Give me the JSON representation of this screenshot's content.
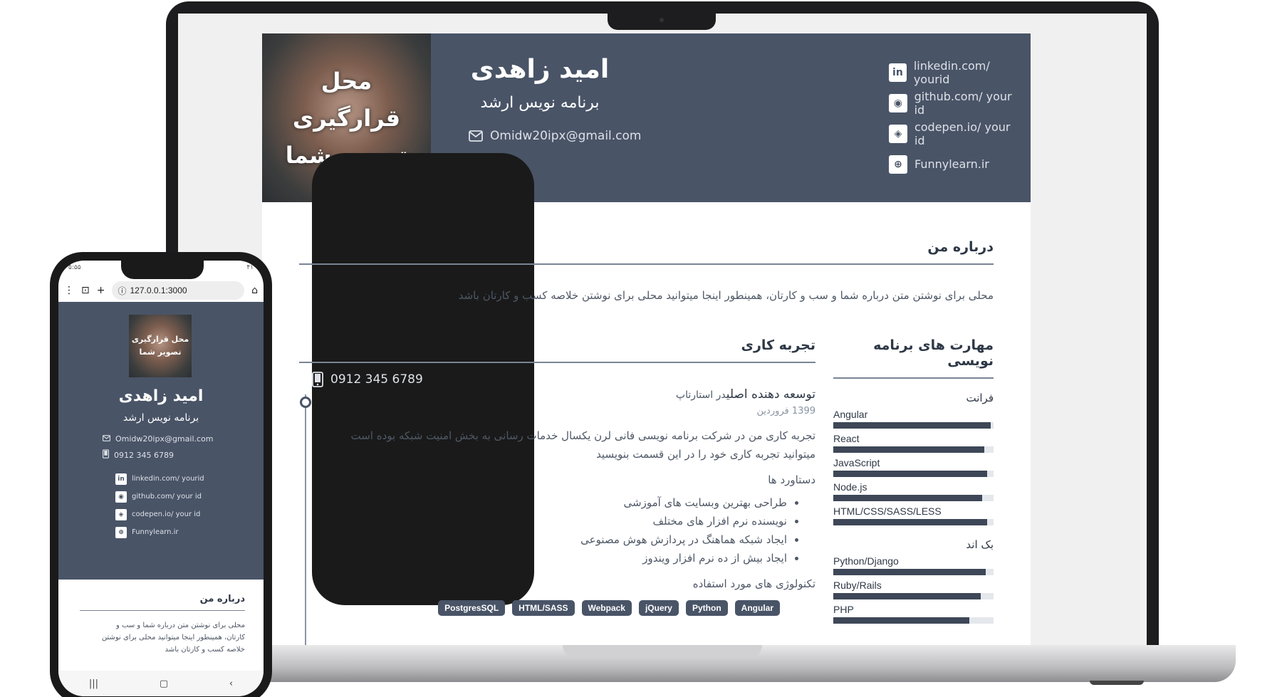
{
  "resume": {
    "photo_placeholder": "محل قرارگیری تصویر شما",
    "name": "امید زاهدی",
    "job_title": "برنامه نویس ارشد",
    "email": "Omidw20ipx@gmail.com",
    "phone": "0912 345 6789",
    "links": [
      {
        "icon": "linkedin-icon",
        "glyph": "in",
        "text": "linkedin.com/ yourid"
      },
      {
        "icon": "github-icon",
        "glyph": "◉",
        "text": "github.com/ your id"
      },
      {
        "icon": "codepen-icon",
        "glyph": "◈",
        "text": "codepen.io/ your id"
      },
      {
        "icon": "globe-icon",
        "glyph": "⊕",
        "text": "Funnylearn.ir"
      }
    ],
    "about_heading": "درباره من",
    "about_text": "محلی برای نوشتن متن درباره شما و سب و کارتان، همینطور اینجا میتوانید محلی برای نوشتن خلاصه کسب و کارتان باشد",
    "skills_heading": "مهارت های برنامه نویسی",
    "skill_groups": [
      {
        "name": "فرانت",
        "items": [
          {
            "label": "Angular",
            "level": 0.98
          },
          {
            "label": "React",
            "level": 0.94
          },
          {
            "label": "JavaScript",
            "level": 0.96
          },
          {
            "label": "Node.js",
            "level": 0.93
          },
          {
            "label": "HTML/CSS/SASS/LESS",
            "level": 0.96
          }
        ]
      },
      {
        "name": "بک اند",
        "items": [
          {
            "label": "Python/Django",
            "level": 0.95
          },
          {
            "label": "Ruby/Rails",
            "level": 0.92
          },
          {
            "label": "PHP",
            "level": 0.85
          }
        ]
      }
    ],
    "experience_heading": "تجربه کاری",
    "job": {
      "title": "توسعه دهنده اصلی",
      "company": "در استارتاپ",
      "date": "1399 فروردین",
      "description": "تجربه کاری من در شرکت برنامه نویسی فانی لرن یکسال خدمات رسانی به بخش امنیت شبکه بوده است میتوانید تجربه کاری خود را در این قسمت بنویسید",
      "achievements_heading": "دستاورد ها",
      "achievements": [
        "طراحی بهترین وبسایت های آموزشی",
        "نویسنده نرم افزار های مختلف",
        "ایجاد شبکه هماهنگ در پردازش هوش مصنوعی",
        "ایجاد بیش از ده نرم افزار ویندوز"
      ],
      "tech_heading": "تکنولوژی های مورد استفاده",
      "tech": [
        "Angular",
        "Python",
        "jQuery",
        "Webpack",
        "HTML/SASS",
        "PostgresSQL"
      ]
    }
  },
  "phone": {
    "status_left": "۵:۵۵",
    "status_right": "۴۱",
    "url": "127.0.0.1:3000",
    "photo_placeholder": "محل قرارگیری تصویر شما",
    "name": "امید زاهدی",
    "job_title": "برنامه نویس ارشد",
    "email": "Omidw20ipx@gmail.com",
    "phone": "0912 345 6789",
    "links": [
      {
        "glyph": "in",
        "text": "linkedin.com/ yourid"
      },
      {
        "glyph": "◉",
        "text": "github.com/ your id"
      },
      {
        "glyph": "◈",
        "text": "codepen.io/ your id"
      },
      {
        "glyph": "⊕",
        "text": "Funnylearn.ir"
      }
    ],
    "about_heading": "درباره من",
    "about_text": "محلی برای نوشتن متن درباره شما و سب و کارتان، همینطور اینجا میتوانید محلی برای نوشتن خلاصه کسب و کارتان باشد",
    "nav": [
      "|||",
      "▢",
      "‹"
    ]
  }
}
